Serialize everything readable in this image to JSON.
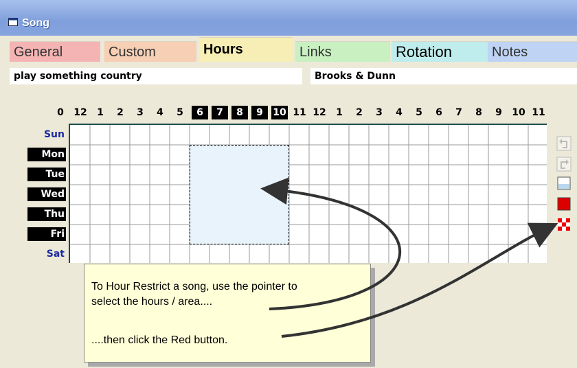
{
  "window": {
    "title": "Song"
  },
  "tabs": [
    {
      "label": "General",
      "color": "#f4b4b4",
      "active": false
    },
    {
      "label": "Custom",
      "color": "#f6cfb4",
      "active": false
    },
    {
      "label": "Hours",
      "color": "#f6eeb4",
      "active": true
    },
    {
      "label": "Links",
      "color": "#c8f0c0",
      "active": false
    },
    {
      "label": "Rotation",
      "color": "#bfecec",
      "active": false
    },
    {
      "label": "Notes",
      "color": "#bfd4f4",
      "active": false
    }
  ],
  "song": {
    "title": "play something country",
    "artist": "Brooks & Dunn"
  },
  "hours": {
    "labels": [
      "0",
      "12",
      "1",
      "2",
      "3",
      "4",
      "5",
      "6",
      "7",
      "8",
      "9",
      "10",
      "11",
      "12",
      "1",
      "2",
      "3",
      "4",
      "5",
      "6",
      "7",
      "8",
      "9",
      "10",
      "11"
    ],
    "selected": [
      "6",
      "7",
      "8",
      "9",
      "10"
    ]
  },
  "days": [
    {
      "label": "Sun",
      "selected": false
    },
    {
      "label": "Mon",
      "selected": true
    },
    {
      "label": "Tue",
      "selected": true
    },
    {
      "label": "Wed",
      "selected": true
    },
    {
      "label": "Thu",
      "selected": true
    },
    {
      "label": "Fri",
      "selected": true
    },
    {
      "label": "Sat",
      "selected": false
    }
  ],
  "toolbar": [
    {
      "name": "undo-button",
      "icon": "undo-icon"
    },
    {
      "name": "redo-button",
      "icon": "redo-icon"
    },
    {
      "name": "clear-button",
      "icon": "clear-icon"
    },
    {
      "name": "restrict-button",
      "icon": "red-square-icon"
    },
    {
      "name": "checker-button",
      "icon": "checker-icon"
    }
  ],
  "callout": {
    "line1": "To Hour Restrict a song, use the pointer to",
    "line2": "select the hours / area....",
    "line3": "....then click the Red button."
  },
  "colors": {
    "accent_red": "#dd0000",
    "grid_line": "#9a9a9a",
    "selection": "#e8f3fb"
  }
}
